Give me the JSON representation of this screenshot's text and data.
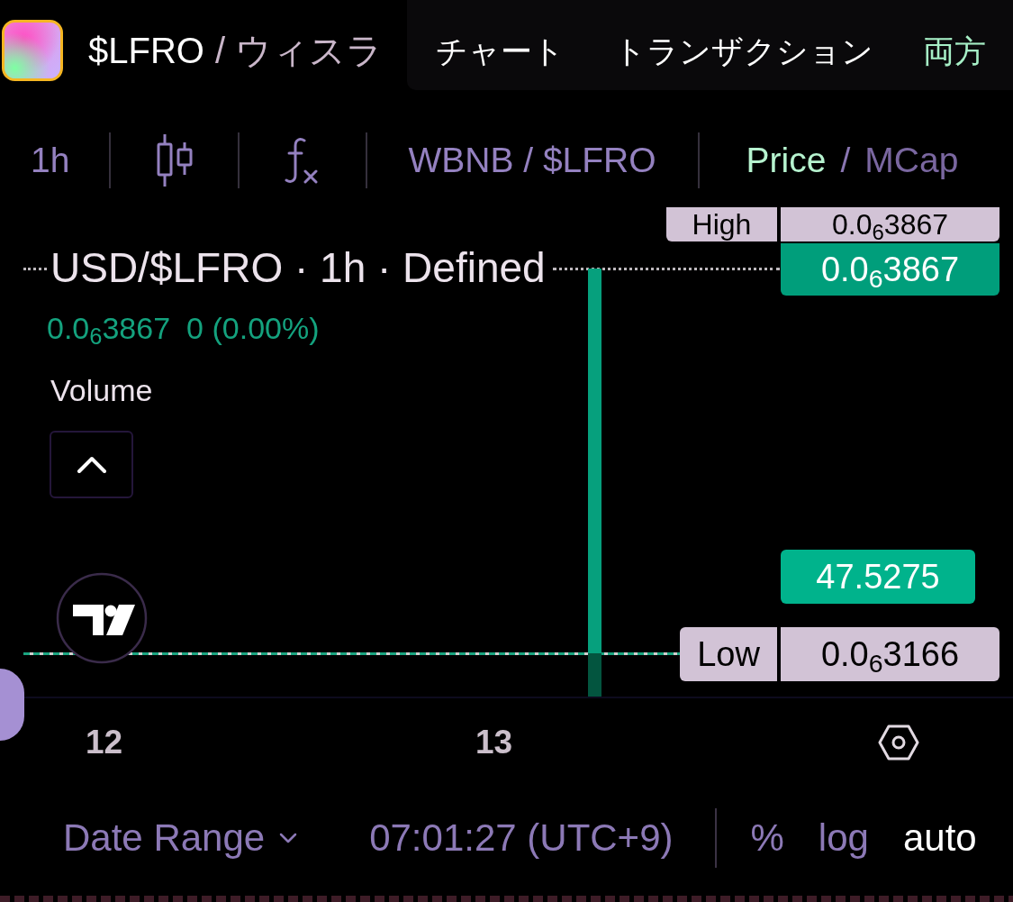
{
  "header": {
    "token": {
      "symbol": "$LFRO",
      "name": "/ ウィスラ"
    },
    "tabs": [
      {
        "label": "チャート",
        "selected": false
      },
      {
        "label": "トランザクション",
        "selected": false
      },
      {
        "label": "両方",
        "selected": true
      }
    ]
  },
  "toolbar": {
    "interval": "1h",
    "pair": "WBNB / $LFRO",
    "modes": [
      {
        "label": "Price",
        "selected": true
      },
      {
        "label": "MCap",
        "selected": false
      }
    ],
    "mode_separator": "/"
  },
  "chart": {
    "legend": {
      "title": "USD/$LFRO · 1h · Defined",
      "price": "0.0$_{6}$3867",
      "change": "0 (0.00%)",
      "volume_label": "Volume"
    },
    "price_tags": [
      {
        "kind": "high",
        "label": "High",
        "value": "0.0$_{6}$3867"
      },
      {
        "kind": "last",
        "value": "0.0$_{6}$3867"
      },
      {
        "kind": "volume",
        "value": "47.5275"
      },
      {
        "kind": "low",
        "label": "Low",
        "value": "0.0$_{6}$3166"
      }
    ],
    "time_labels": [
      "12",
      "13"
    ]
  },
  "footer": {
    "date_range": "Date Range",
    "clock": "07:01:27 (UTC+9)",
    "scale_options": [
      {
        "label": "%",
        "selected": false
      },
      {
        "label": "log",
        "selected": false
      },
      {
        "label": "auto",
        "selected": true
      }
    ]
  }
}
